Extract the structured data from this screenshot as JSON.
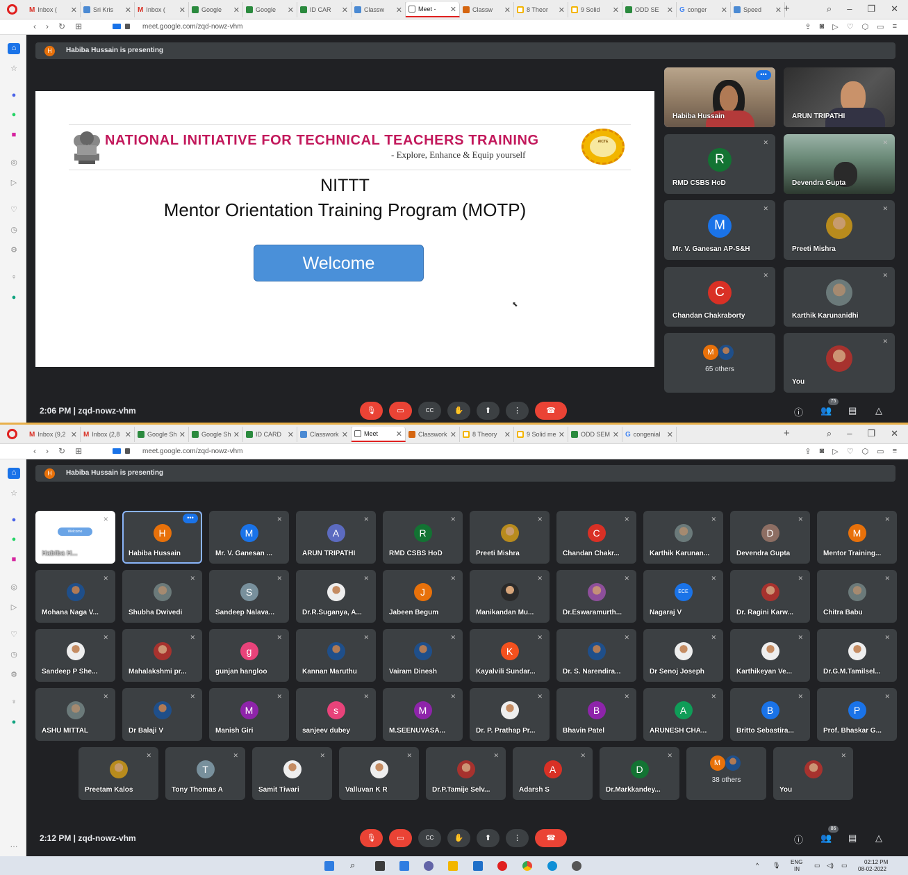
{
  "screen1": {
    "tabs": [
      {
        "label": "Inbox (",
        "fav": "gm"
      },
      {
        "label": "Sri Kris",
        "fav": "bl"
      },
      {
        "label": "Inbox (",
        "fav": "gm"
      },
      {
        "label": "Google",
        "fav": ""
      },
      {
        "label": "Google",
        "fav": ""
      },
      {
        "label": "ID CAR",
        "fav": ""
      },
      {
        "label": "Classw",
        "fav": "bl"
      },
      {
        "label": "Meet -",
        "fav": "mt",
        "active": true
      },
      {
        "label": "Classw",
        "fav": "or"
      },
      {
        "label": "8 Theor",
        "fav": "yl"
      },
      {
        "label": "9 Solid",
        "fav": "yl"
      },
      {
        "label": "ODD SE",
        "fav": ""
      },
      {
        "label": "conger",
        "fav": "gg"
      },
      {
        "label": "Speed",
        "fav": "bl"
      }
    ],
    "url": "meet.google.com/zqd-nowz-vhm",
    "presenting": "Habiba Hussain is presenting",
    "presenter_initial": "H",
    "slide": {
      "org_name": "NATIONAL INITIATIVE FOR TECHNICAL TEACHERS TRAINING",
      "tagline": "- Explore, Enhance & Equip yourself",
      "seal_text": "AICTE",
      "heading": "NITTT",
      "subtitle": "Mentor Orientation Training Program (MOTP)",
      "button": "Welcome"
    },
    "tiles": [
      {
        "name": "Habiba Hussain",
        "kind": "video-f",
        "speaking": true,
        "more": true
      },
      {
        "name": "ARUN TRIPATHI",
        "kind": "video-m"
      },
      {
        "name": "RMD CSBS HoD",
        "initial": "R",
        "color": "#137333"
      },
      {
        "name": "Devendra Gupta",
        "kind": "video-d"
      },
      {
        "name": "Mr. V. Ganesan AP-S&H",
        "initial": "M",
        "color": "#1a73e8"
      },
      {
        "name": "Preeti Mishra",
        "photo": "y"
      },
      {
        "name": "Chandan Chakraborty",
        "initial": "C",
        "color": "#d93025"
      },
      {
        "name": "Karthik Karunanidhi",
        "photo": "g"
      },
      {
        "name": "65 others",
        "others": true,
        "initial": "M"
      },
      {
        "name": "You",
        "photo": "r"
      }
    ],
    "time_meeting": "2:06 PM  |  zqd-nowz-vhm",
    "people_count": "75"
  },
  "screen2": {
    "tabs": [
      {
        "label": "Inbox (9,2",
        "fav": "gm"
      },
      {
        "label": "Inbox (2,8",
        "fav": "gm"
      },
      {
        "label": "Google Sh",
        "fav": ""
      },
      {
        "label": "Google Sh",
        "fav": ""
      },
      {
        "label": "ID CARD",
        "fav": ""
      },
      {
        "label": "Classwork",
        "fav": "bl"
      },
      {
        "label": "Meet",
        "fav": "mt",
        "active": true
      },
      {
        "label": "Classwork",
        "fav": "or"
      },
      {
        "label": "8 Theory",
        "fav": "yl"
      },
      {
        "label": "9 Solid me",
        "fav": "yl"
      },
      {
        "label": "ODD SEM",
        "fav": ""
      },
      {
        "label": "congenial",
        "fav": "gg"
      }
    ],
    "url": "meet.google.com/zqd-nowz-vhm",
    "presenting": "Habiba Hussain is presenting",
    "presenter_initial": "H",
    "thumb_slide_label": "Habiba H...",
    "thumb_welcome": "Welcome",
    "rows": [
      [
        {
          "name": "Habiba Hussain",
          "initial": "H",
          "color": "#e8710a",
          "speaking": true,
          "more": true
        },
        {
          "name": "Mr. V. Ganesan ...",
          "initial": "M",
          "color": "#1a73e8"
        },
        {
          "name": "ARUN TRIPATHI",
          "initial": "A",
          "color": "#5c6bc0"
        },
        {
          "name": "RMD CSBS HoD",
          "initial": "R",
          "color": "#137333"
        },
        {
          "name": "Preeti Mishra",
          "photo": "y"
        },
        {
          "name": "Chandan Chakr...",
          "initial": "C",
          "color": "#d93025"
        },
        {
          "name": "Karthik Karunan...",
          "photo": "g"
        },
        {
          "name": "Devendra Gupta",
          "initial": "D",
          "color": "#8d6e63"
        },
        {
          "name": "Mentor Training...",
          "initial": "M",
          "color": "#e8710a"
        }
      ],
      [
        {
          "name": "Mohana Naga V...",
          "photo": "b"
        },
        {
          "name": "Shubha Dwivedi",
          "photo": "g"
        },
        {
          "name": "Sandeep Nalava...",
          "initial": "S",
          "color": "#78909c"
        },
        {
          "name": "Dr.R.Suganya, A...",
          "photo": "w"
        },
        {
          "name": "Jabeen Begum",
          "initial": "J",
          "color": "#e8710a"
        },
        {
          "name": "Manikandan Mu...",
          "photo": ""
        },
        {
          "name": "Dr.Eswaramurth...",
          "photo": "v"
        },
        {
          "name": "Nagaraj V",
          "initial": "ECE",
          "color": "#1a73e8",
          "small": true
        },
        {
          "name": "Dr. Ragini Karw...",
          "photo": "r"
        },
        {
          "name": "Chitra Babu",
          "photo": "g"
        }
      ],
      [
        {
          "name": "Sandeep P She...",
          "photo": "w"
        },
        {
          "name": "Mahalakshmi pr...",
          "photo": "r"
        },
        {
          "name": "gunjan hangloo",
          "initial": "g",
          "color": "#e8437a"
        },
        {
          "name": "Kannan Maruthu",
          "photo": "b"
        },
        {
          "name": "Vairam Dinesh",
          "photo": "b"
        },
        {
          "name": "Kayalvili Sundar...",
          "initial": "K",
          "color": "#f4511e"
        },
        {
          "name": "Dr. S. Narendira...",
          "photo": "b"
        },
        {
          "name": "Dr Senoj Joseph",
          "photo": "w"
        },
        {
          "name": "Karthikeyan Ve...",
          "photo": "w"
        },
        {
          "name": "Dr.G.M.Tamilsel...",
          "photo": "w"
        }
      ],
      [
        {
          "name": "ASHU MITTAL",
          "photo": "g"
        },
        {
          "name": "Dr Balaji V",
          "photo": "b"
        },
        {
          "name": "Manish Giri",
          "initial": "M",
          "color": "#8e24aa"
        },
        {
          "name": "sanjeev dubey",
          "initial": "s",
          "color": "#e8437a"
        },
        {
          "name": "M.SEENUVASA...",
          "initial": "M",
          "color": "#8e24aa"
        },
        {
          "name": "Dr. P. Prathap Pr...",
          "photo": "w"
        },
        {
          "name": "Bhavin Patel",
          "initial": "B",
          "color": "#8e24aa"
        },
        {
          "name": "ARUNESH CHA...",
          "initial": "A",
          "color": "#0f9d58"
        },
        {
          "name": "Britto Sebastira...",
          "initial": "B",
          "color": "#1a73e8"
        },
        {
          "name": "Prof. Bhaskar G...",
          "initial": "P",
          "color": "#1a73e8"
        }
      ],
      [
        {
          "name": "Preetam Kalos",
          "photo": "y"
        },
        {
          "name": "Tony Thomas A",
          "initial": "T",
          "color": "#78909c"
        },
        {
          "name": "Samit Tiwari",
          "photo": "w"
        },
        {
          "name": "Valluvan K R",
          "photo": "w"
        },
        {
          "name": "Dr.P.Tamije Selv...",
          "photo": "r"
        },
        {
          "name": "Adarsh S",
          "initial": "A",
          "color": "#d93025"
        },
        {
          "name": "Dr.Markkandey...",
          "initial": "D",
          "color": "#137333"
        },
        {
          "name": "38 others",
          "others": true,
          "initial": "M"
        },
        {
          "name": "You",
          "photo": "r"
        }
      ]
    ],
    "time_meeting": "2:12 PM  |  zqd-nowz-vhm",
    "people_count": "86"
  },
  "taskbar": {
    "lang": "ENG",
    "region": "IN",
    "time": "02:12 PM",
    "date": "08-02-2022"
  },
  "icons": {
    "mic_off": "mic-off-icon",
    "cam_off": "camera-off-icon",
    "captions": "captions-icon",
    "hand": "raise-hand-icon",
    "present": "present-icon",
    "more": "more-options-icon",
    "end": "end-call-icon",
    "info": "info-icon",
    "people": "people-icon",
    "chat": "chat-icon",
    "activities": "activities-icon"
  }
}
